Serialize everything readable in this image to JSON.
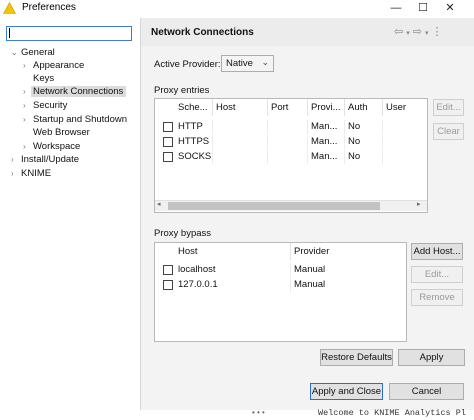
{
  "window": {
    "title": "Preferences",
    "buttons": {
      "minimize": "—",
      "maximize": "☐",
      "close": "✕"
    }
  },
  "tree": {
    "items": [
      {
        "label": "General",
        "level": 0,
        "twisty": "⌄"
      },
      {
        "label": "Appearance",
        "level": 1,
        "twisty": "›"
      },
      {
        "label": "Keys",
        "level": 1,
        "twisty": ""
      },
      {
        "label": "Network Connections",
        "level": 1,
        "twisty": "›",
        "selected": true
      },
      {
        "label": "Security",
        "level": 1,
        "twisty": "›"
      },
      {
        "label": "Startup and Shutdown",
        "level": 1,
        "twisty": "›"
      },
      {
        "label": "Web Browser",
        "level": 1,
        "twisty": ""
      },
      {
        "label": "Workspace",
        "level": 1,
        "twisty": "›"
      },
      {
        "label": "Install/Update",
        "level": 0,
        "twisty": "›"
      },
      {
        "label": "KNIME",
        "level": 0,
        "twisty": "›"
      }
    ]
  },
  "page": {
    "title": "Network Connections",
    "active_provider_label": "Active Provider:",
    "active_provider_value": "Native",
    "proxy_entries": {
      "title": "Proxy entries",
      "columns": [
        "Sche...",
        "Host",
        "Port",
        "Provi...",
        "Auth",
        "User"
      ],
      "rows": [
        {
          "scheme": "HTTP",
          "host": "",
          "port": "",
          "provider": "Man...",
          "auth": "No",
          "user": ""
        },
        {
          "scheme": "HTTPS",
          "host": "",
          "port": "",
          "provider": "Man...",
          "auth": "No",
          "user": ""
        },
        {
          "scheme": "SOCKS",
          "host": "",
          "port": "",
          "provider": "Man...",
          "auth": "No",
          "user": ""
        }
      ],
      "buttons": {
        "edit": "Edit...",
        "clear": "Clear"
      }
    },
    "proxy_bypass": {
      "title": "Proxy bypass",
      "columns": [
        "Host",
        "Provider"
      ],
      "rows": [
        {
          "host": "localhost",
          "provider": "Manual"
        },
        {
          "host": "127.0.0.1",
          "provider": "Manual"
        }
      ],
      "buttons": {
        "add_host": "Add Host...",
        "edit": "Edit...",
        "remove": "Remove"
      }
    },
    "restore_defaults": "Restore Defaults",
    "apply": "Apply"
  },
  "footer": {
    "apply_and_close": "Apply and Close",
    "cancel": "Cancel"
  },
  "background": {
    "console_text": "Welcome to KNIME Analytics Pl",
    "dots": "• • •"
  },
  "colors": {
    "accent": "#2a6fd0",
    "selection": "#dcdcdc",
    "warning_icon": "#f5c400"
  }
}
